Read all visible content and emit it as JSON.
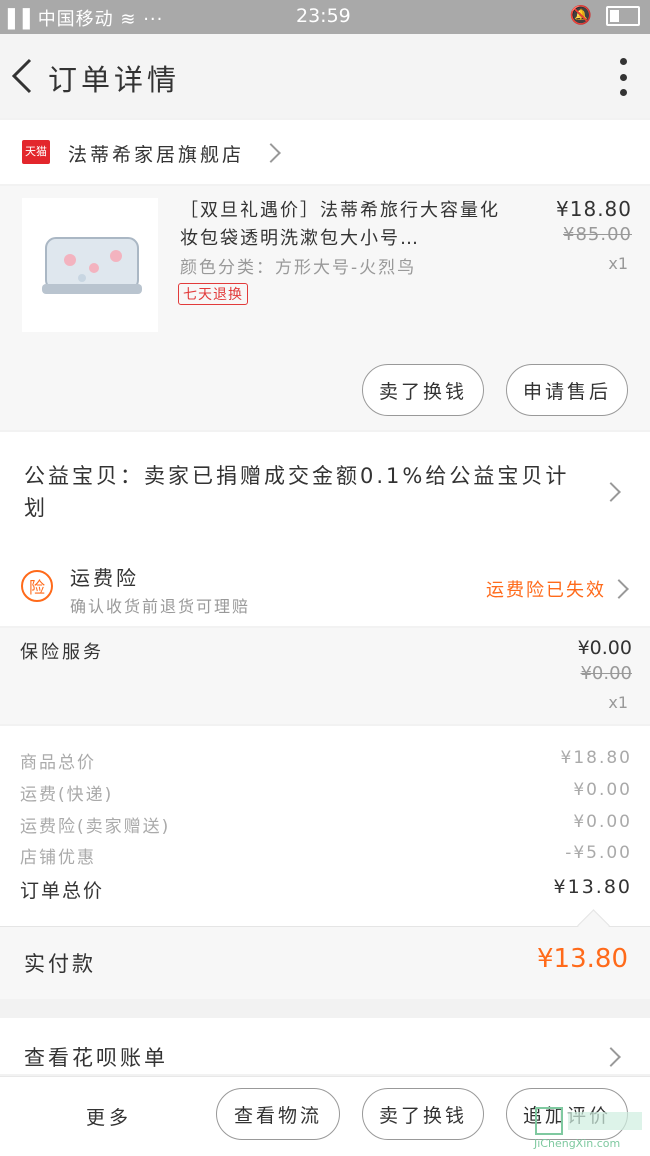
{
  "status_bar": {
    "carrier": "中国移动",
    "time": "23:59"
  },
  "header": {
    "title": "订单详情"
  },
  "shop": {
    "badge": "天猫",
    "name": "法蒂希家居旗舰店"
  },
  "product": {
    "title": "［双旦礼遇价］法蒂希旅行大容量化妆包袋透明洗漱包大小号…",
    "attributes": "颜色分类：方形大号-火烈鸟",
    "badge": "七天退换",
    "price": "¥18.80",
    "original_price": "¥85.00",
    "quantity": "x1",
    "actions": {
      "sell_label": "卖了换钱",
      "aftersale_label": "申请售后"
    }
  },
  "charity": {
    "text": "公益宝贝：卖家已捐赠成交金额0.1%给公益宝贝计划"
  },
  "shipping_insurance": {
    "icon_char": "险",
    "title": "运费险",
    "subtitle": "确认收货前退货可理赔",
    "status": "运费险已失效"
  },
  "insurance_service": {
    "name": "保险服务",
    "price": "¥0.00",
    "original_price": "¥0.00",
    "quantity": "x1"
  },
  "summary": {
    "rows": [
      {
        "label": "商品总价",
        "value": "¥18.80"
      },
      {
        "label": "运费(快递)",
        "value": "¥0.00"
      },
      {
        "label": "运费险(卖家赠送)",
        "value": "¥0.00"
      },
      {
        "label": "店铺优惠",
        "value": "-¥5.00"
      }
    ],
    "total": {
      "label": "订单总价",
      "value": "¥13.80"
    }
  },
  "paid": {
    "label": "实付款",
    "value": "¥13.80"
  },
  "huabei": {
    "label": "查看花呗账单"
  },
  "bottom_bar": {
    "more_label": "更多",
    "logistics_label": "查看物流",
    "sell_label": "卖了换钱",
    "review_label": "追加评价"
  },
  "watermark": {
    "text": "JiChengXin.com"
  },
  "colors": {
    "accent": "#ff6a1a",
    "tmall_red": "#e3262c",
    "badge_red": "#e23b3b"
  }
}
